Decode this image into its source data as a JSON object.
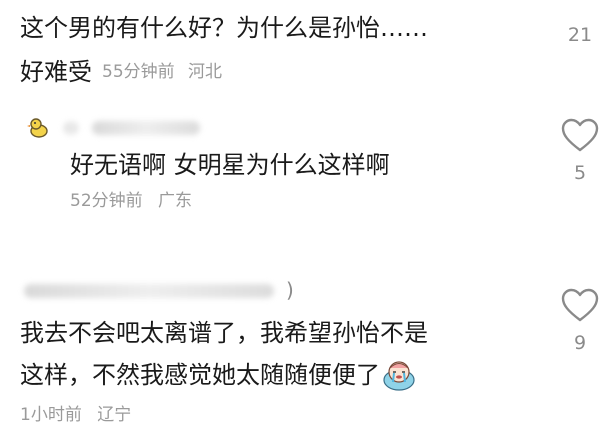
{
  "comments": [
    {
      "text_line1": "这个男的有什么好？为什么是孙怡……",
      "text_line2": "好难受",
      "time": "55分钟前",
      "location": "河北",
      "likes": "21"
    },
    {
      "text_line1": "我去不会吧太离谱了，我希望孙怡不是",
      "text_line2": "这样，不然我感觉她太随随便便了",
      "time": "1小时前",
      "location": "辽宁",
      "likes": "9",
      "name_suffix": ")"
    }
  ],
  "reply": {
    "text": "好无语啊 女明星为什么这样啊",
    "time": "52分钟前",
    "location": "广东",
    "likes": "5"
  },
  "icons": {
    "like": "heart-outline-icon",
    "reply_avatar": "duck-avatar-icon",
    "emoji": "crying-sticker-icon"
  },
  "colors": {
    "text": "#1a1a1a",
    "meta": "#9a9a9a",
    "icon": "#8a8a8a"
  }
}
